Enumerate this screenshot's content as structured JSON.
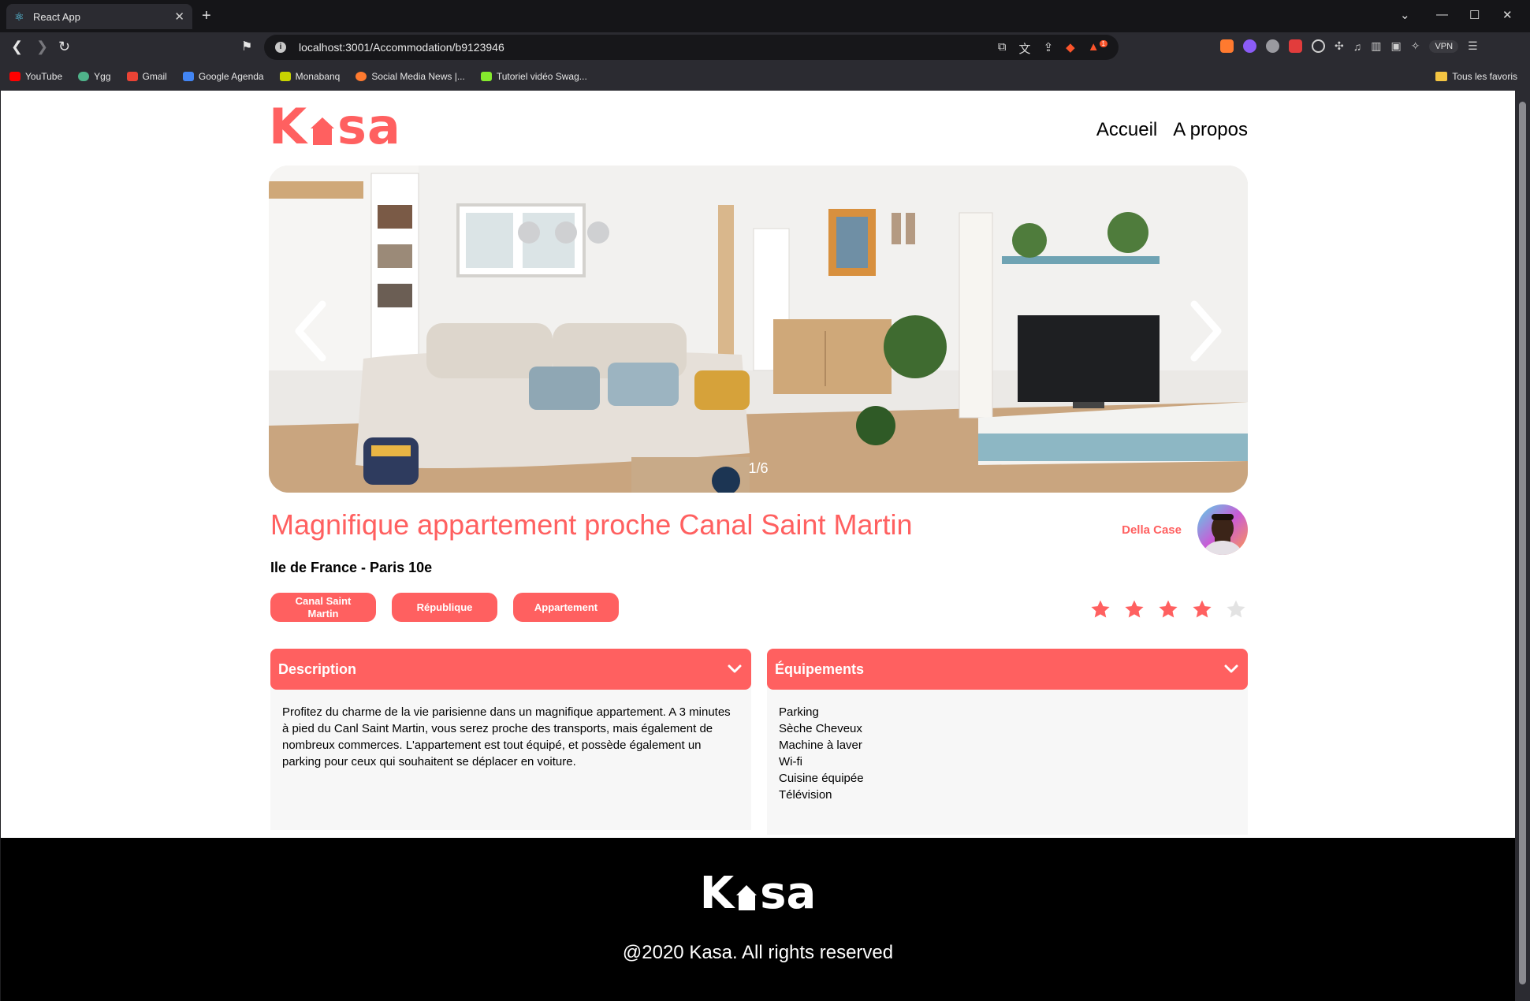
{
  "browser": {
    "tab_title": "React App",
    "tab_favicon": "react-icon",
    "url": "localhost:3001/Accommodation/b9123946",
    "vpn_label": "VPN",
    "notification_count": "1",
    "bookmarks": [
      {
        "label": "YouTube",
        "icon": "youtube-icon",
        "color": "#ff0000"
      },
      {
        "label": "Ygg",
        "icon": "ygg-icon",
        "color": "#4fb38a"
      },
      {
        "label": "Gmail",
        "icon": "gmail-icon",
        "color": "#ea4335"
      },
      {
        "label": "Google Agenda",
        "icon": "google-agenda-icon",
        "color": "#4285f4"
      },
      {
        "label": "Monabanq",
        "icon": "monabanq-icon",
        "color": "#c8d400"
      },
      {
        "label": "Social Media News |...",
        "icon": "social-media-news-icon",
        "color": "#ff7a2f"
      },
      {
        "label": "Tutoriel vidéo Swag...",
        "icon": "swagger-icon",
        "color": "#85ea2d"
      }
    ],
    "bookmarks_right": "Tous les favoris"
  },
  "site": {
    "logo_left": "K",
    "logo_right": "sa",
    "nav": {
      "home": "Accueil",
      "about": "A propos"
    },
    "accent_color": "#ff6060"
  },
  "listing": {
    "gallery_counter": "1/6",
    "title": "Magnifique appartement proche Canal Saint Martin",
    "location": "Ile de France - Paris 10e",
    "host_name": "Della Case",
    "tags": [
      "Canal Saint Martin",
      "République",
      "Appartement"
    ],
    "rating": 4,
    "rating_max": 5,
    "description_title": "Description",
    "description": "Profitez du charme de la vie parisienne dans un magnifique appartement. A 3 minutes à pied du Canl Saint Martin, vous serez proche des transports, mais également de nombreux commerces. L'appartement est tout équipé, et possède également un parking pour ceux qui souhaitent se déplacer en voiture.",
    "equipments_title": "Équipements",
    "equipments": [
      "Parking",
      "Sèche Cheveux",
      "Machine à laver",
      "Wi-fi",
      "Cuisine équipée",
      "Télévision"
    ]
  },
  "footer": {
    "logo_left": "K",
    "logo_right": "sa",
    "copyright": "@2020 Kasa. All rights reserved"
  }
}
